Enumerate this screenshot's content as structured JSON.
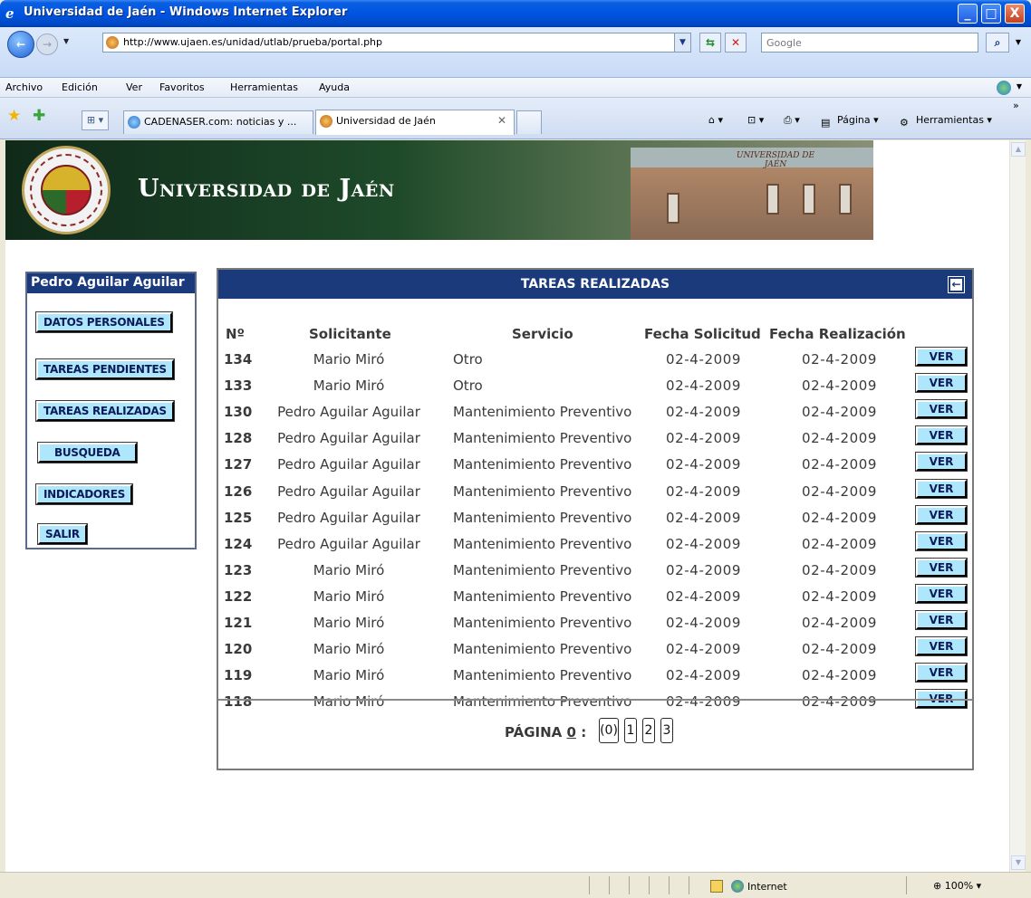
{
  "window": {
    "title": "Universidad de Jaén - Windows Internet Explorer",
    "minimize": "_",
    "maximize": "□",
    "close": "X"
  },
  "address": {
    "url": "http://www.ujaen.es/unidad/utlab/prueba/portal.php",
    "search_placeholder": "Google"
  },
  "menu": [
    "Archivo",
    "Edición",
    "Ver",
    "Favoritos",
    "Herramientas",
    "Ayuda"
  ],
  "tabs": [
    {
      "label": "CADENASER.com: noticias y ..."
    },
    {
      "label": "Universidad de Jaén"
    }
  ],
  "commands": {
    "page": "Página",
    "tools": "Herramientas"
  },
  "banner": {
    "name": "Universidad de Jaén",
    "building_sign": "UNIVERSIDAD DE JAÉN"
  },
  "sidebar": {
    "user": "Pedro Aguilar Aguilar",
    "items": [
      {
        "label": "DATOS PERSONALES"
      },
      {
        "label": "TAREAS PENDIENTES"
      },
      {
        "label": "TAREAS REALIZADAS"
      },
      {
        "label": "BUSQUEDA"
      },
      {
        "label": "INDICADORES"
      },
      {
        "label": "SALIR"
      }
    ]
  },
  "panel": {
    "title": "TAREAS REALIZADAS",
    "columns": {
      "num": "Nº",
      "solicitante": "Solicitante",
      "servicio": "Servicio",
      "fecha_solicitud": "Fecha Solicitud",
      "fecha_realizacion": "Fecha Realización"
    },
    "rows": [
      {
        "num": "134",
        "solicitante": "Mario Miró",
        "servicio": "Otro",
        "fecha_solicitud": "02-4-2009",
        "fecha_realizacion": "02-4-2009",
        "action": "VER"
      },
      {
        "num": "133",
        "solicitante": "Mario Miró",
        "servicio": "Otro",
        "fecha_solicitud": "02-4-2009",
        "fecha_realizacion": "02-4-2009",
        "action": "VER"
      },
      {
        "num": "130",
        "solicitante": "Pedro Aguilar Aguilar",
        "servicio": "Mantenimiento Preventivo",
        "fecha_solicitud": "02-4-2009",
        "fecha_realizacion": "02-4-2009",
        "action": "VER"
      },
      {
        "num": "128",
        "solicitante": "Pedro Aguilar Aguilar",
        "servicio": "Mantenimiento Preventivo",
        "fecha_solicitud": "02-4-2009",
        "fecha_realizacion": "02-4-2009",
        "action": "VER"
      },
      {
        "num": "127",
        "solicitante": "Pedro Aguilar Aguilar",
        "servicio": "Mantenimiento Preventivo",
        "fecha_solicitud": "02-4-2009",
        "fecha_realizacion": "02-4-2009",
        "action": "VER"
      },
      {
        "num": "126",
        "solicitante": "Pedro Aguilar Aguilar",
        "servicio": "Mantenimiento Preventivo",
        "fecha_solicitud": "02-4-2009",
        "fecha_realizacion": "02-4-2009",
        "action": "VER"
      },
      {
        "num": "125",
        "solicitante": "Pedro Aguilar Aguilar",
        "servicio": "Mantenimiento Preventivo",
        "fecha_solicitud": "02-4-2009",
        "fecha_realizacion": "02-4-2009",
        "action": "VER"
      },
      {
        "num": "124",
        "solicitante": "Pedro Aguilar Aguilar",
        "servicio": "Mantenimiento Preventivo",
        "fecha_solicitud": "02-4-2009",
        "fecha_realizacion": "02-4-2009",
        "action": "VER"
      },
      {
        "num": "123",
        "solicitante": "Mario Miró",
        "servicio": "Mantenimiento Preventivo",
        "fecha_solicitud": "02-4-2009",
        "fecha_realizacion": "02-4-2009",
        "action": "VER"
      },
      {
        "num": "122",
        "solicitante": "Mario Miró",
        "servicio": "Mantenimiento Preventivo",
        "fecha_solicitud": "02-4-2009",
        "fecha_realizacion": "02-4-2009",
        "action": "VER"
      },
      {
        "num": "121",
        "solicitante": "Mario Miró",
        "servicio": "Mantenimiento Preventivo",
        "fecha_solicitud": "02-4-2009",
        "fecha_realizacion": "02-4-2009",
        "action": "VER"
      },
      {
        "num": "120",
        "solicitante": "Mario Miró",
        "servicio": "Mantenimiento Preventivo",
        "fecha_solicitud": "02-4-2009",
        "fecha_realizacion": "02-4-2009",
        "action": "VER"
      },
      {
        "num": "119",
        "solicitante": "Mario Miró",
        "servicio": "Mantenimiento Preventivo",
        "fecha_solicitud": "02-4-2009",
        "fecha_realizacion": "02-4-2009",
        "action": "VER"
      },
      {
        "num": "118",
        "solicitante": "Mario Miró",
        "servicio": "Mantenimiento Preventivo",
        "fecha_solicitud": "02-4-2009",
        "fecha_realizacion": "02-4-2009",
        "action": "VER"
      }
    ],
    "pager": {
      "label": "PÁGINA",
      "current": "0",
      "separator": ":",
      "pages": [
        "(0)",
        "1",
        "2",
        "3"
      ]
    }
  },
  "status": {
    "zone": "Internet",
    "zoom": "100%"
  },
  "colors": {
    "header_bg": "#1b3a7c",
    "button_bg": "#aee7fb",
    "titlebar": "#0054e3"
  }
}
